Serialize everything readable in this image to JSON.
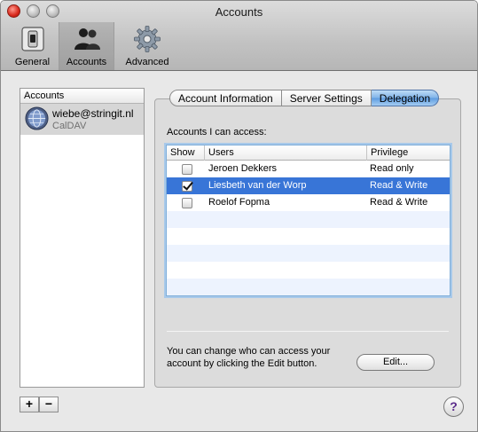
{
  "window": {
    "title": "Accounts"
  },
  "toolbar": {
    "items": [
      {
        "label": "General",
        "icon": "switch-icon",
        "selected": false
      },
      {
        "label": "Accounts",
        "icon": "people-icon",
        "selected": true
      },
      {
        "label": "Advanced",
        "icon": "gear-icon",
        "selected": false
      }
    ]
  },
  "sidebar": {
    "header": "Accounts",
    "accounts": [
      {
        "name": "wiebe@stringit.nl",
        "type": "CalDAV",
        "icon": "globe-icon"
      }
    ],
    "add_label": "+",
    "remove_label": "−"
  },
  "tabs": [
    {
      "label": "Account Information",
      "active": false
    },
    {
      "label": "Server Settings",
      "active": false
    },
    {
      "label": "Delegation",
      "active": true
    }
  ],
  "delegation": {
    "section_label": "Accounts I can access:",
    "columns": [
      "Show",
      "Users",
      "Privilege"
    ],
    "rows": [
      {
        "show": false,
        "user": "Jeroen Dekkers",
        "privilege": "Read only"
      },
      {
        "show": true,
        "user": "Liesbeth van der Worp",
        "privilege": "Read & Write"
      },
      {
        "show": false,
        "user": "Roelof Fopma",
        "privilege": "Read & Write"
      }
    ],
    "info_text": "You can change who can access your account by clicking the Edit button.",
    "edit_label": "Edit..."
  },
  "help_label": "?",
  "colors": {
    "selection": "#3875d7",
    "active_tab": "#7fb3e8",
    "stripe": "#edf3fe"
  }
}
